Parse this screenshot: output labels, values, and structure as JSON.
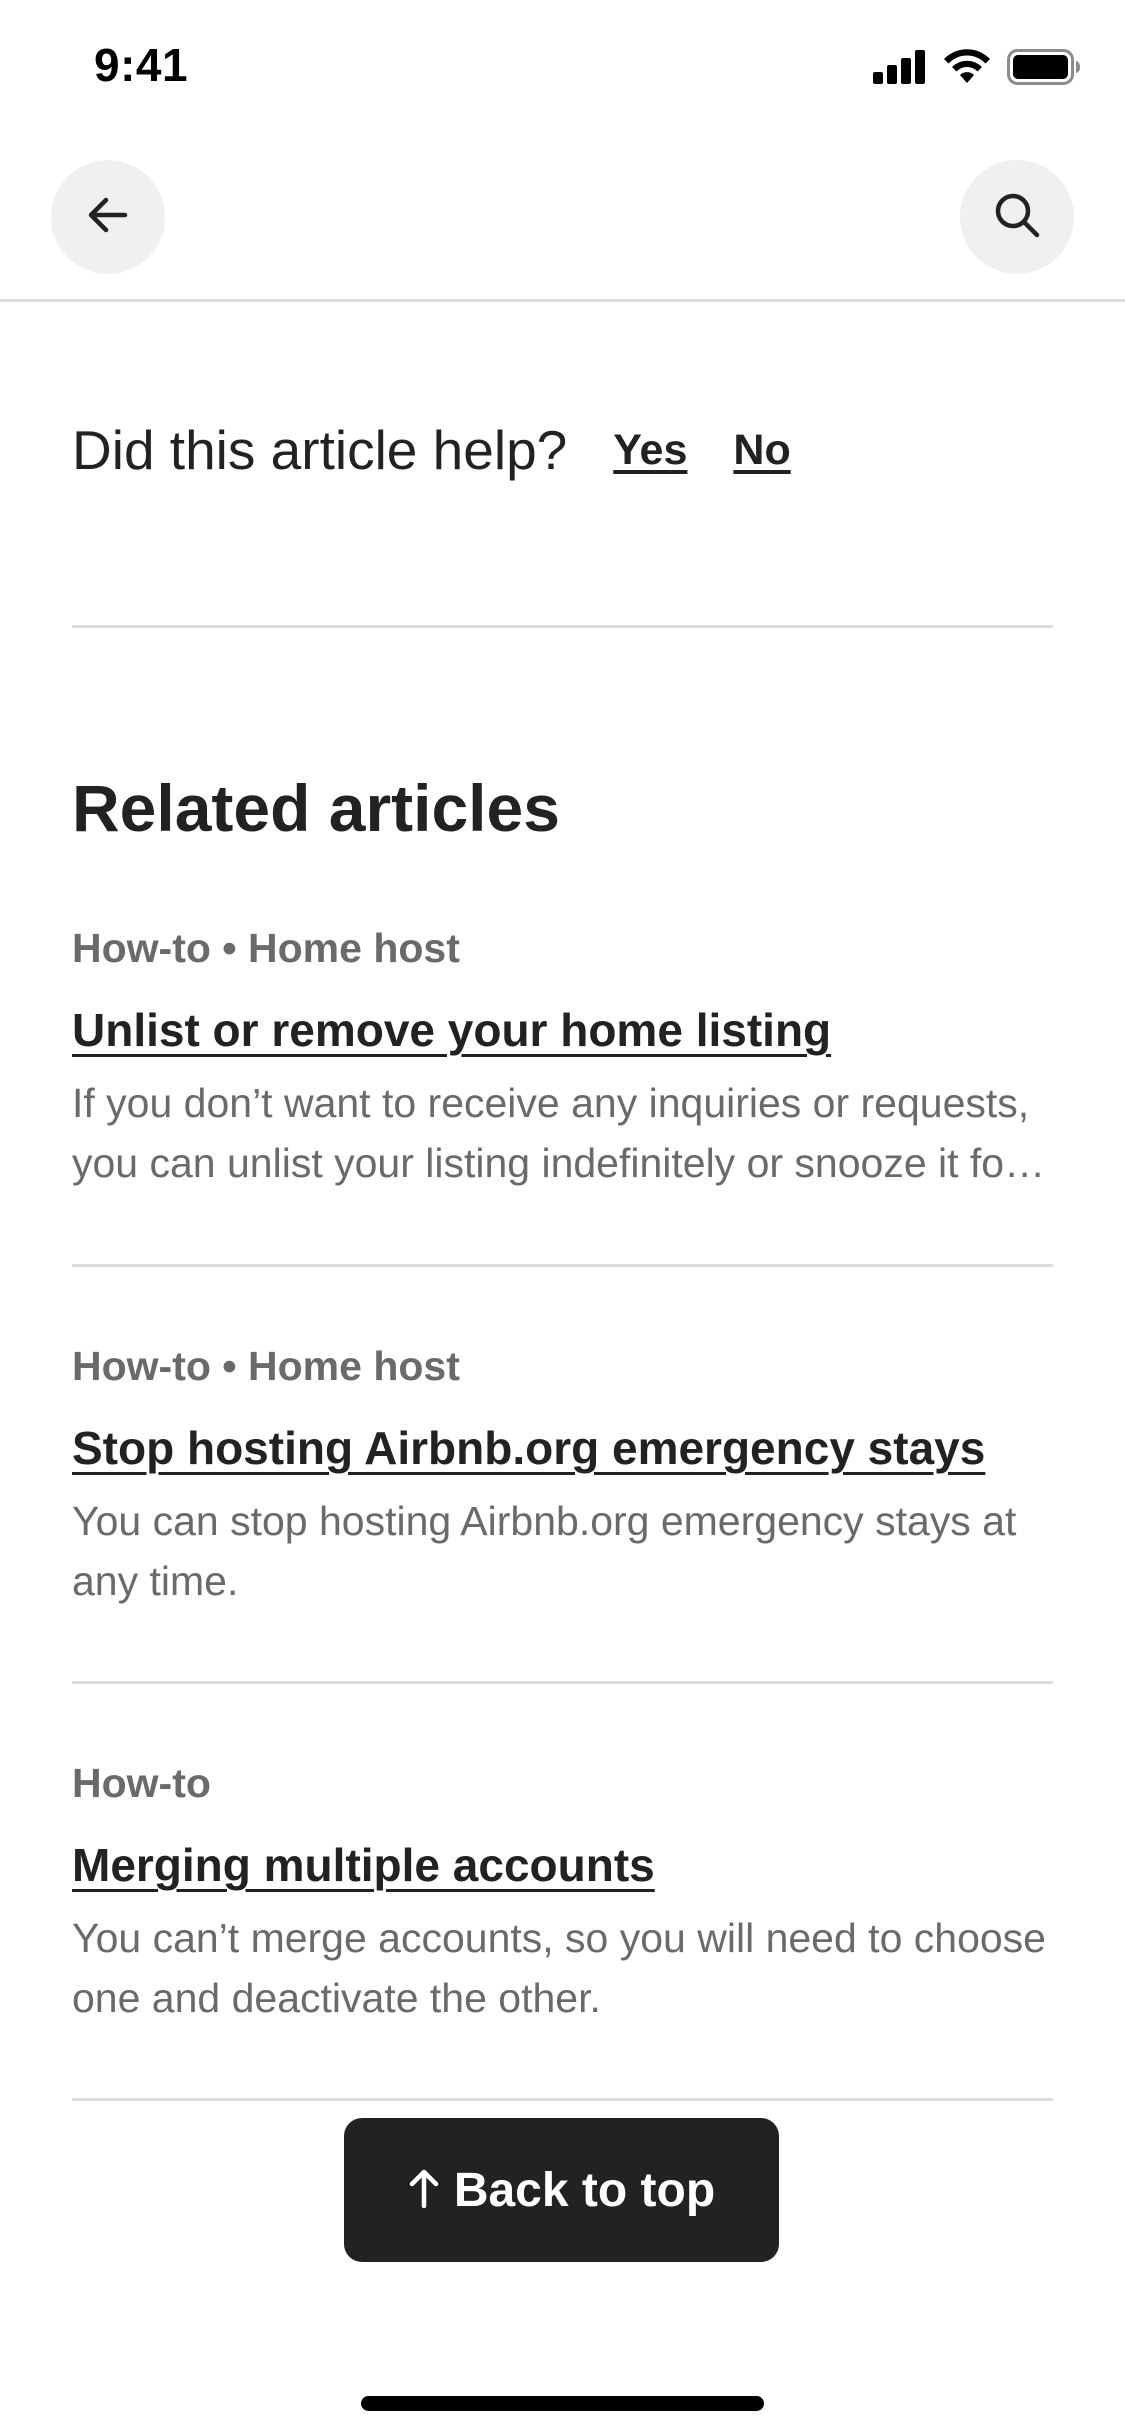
{
  "status_bar": {
    "time": "9:41",
    "icons": [
      "cellular-signal-icon",
      "wifi-icon",
      "battery-icon"
    ]
  },
  "header": {
    "back_icon": "arrow-left-icon",
    "search_icon": "search-icon"
  },
  "feedback": {
    "question": "Did this article help?",
    "yes": "Yes",
    "no": "No"
  },
  "related": {
    "title": "Related articles",
    "articles": [
      {
        "meta": "How-to • Home host",
        "title": "Unlist or remove your home listing",
        "description": "If you don’t want to receive any inquiries or requests, you can unlist your listing indefinitely or snooze it for a specific date range."
      },
      {
        "meta": "How-to • Home host",
        "title": "Stop hosting Airbnb.org emergency stays",
        "description": "You can stop hosting Airbnb.org emergency stays at any time."
      },
      {
        "meta": "How-to",
        "title": "Merging multiple accounts",
        "description": "You can’t merge accounts, so you will need to choose one and deactivate the other."
      }
    ]
  },
  "back_to_top": {
    "icon": "arrow-up-icon",
    "label": "Back to top"
  },
  "colors": {
    "text_primary": "#222222",
    "text_secondary": "#6a6a6a",
    "divider": "#dddddd",
    "button_bg": "#222222"
  }
}
